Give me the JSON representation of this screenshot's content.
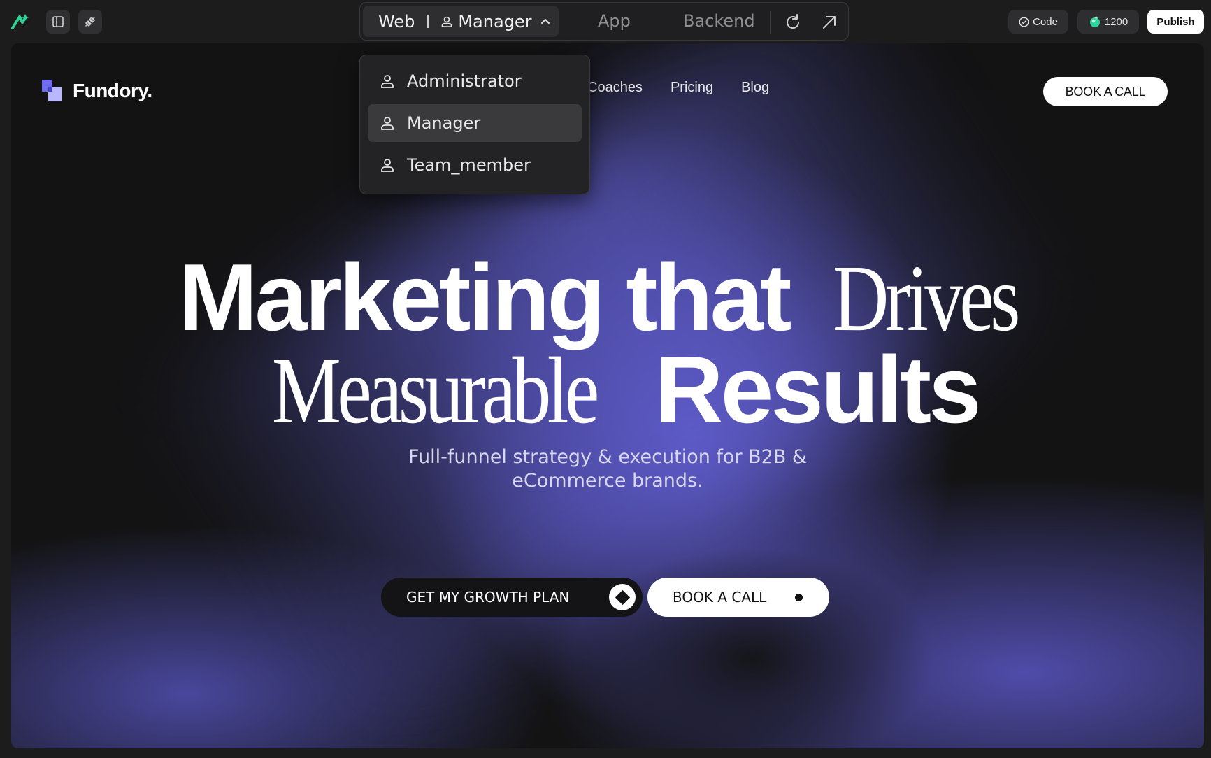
{
  "topbar": {
    "env_tabs": {
      "web": "Web",
      "role": "Manager",
      "app": "App",
      "backend": "Backend"
    },
    "code_label": "Code",
    "credits": "1200",
    "publish_label": "Publish"
  },
  "role_dropdown": {
    "items": [
      {
        "label": "Administrator"
      },
      {
        "label": "Manager",
        "selected": true
      },
      {
        "label": "Team_member"
      }
    ]
  },
  "site": {
    "brand": "Fundory.",
    "nav": [
      "Coaches",
      "Pricing",
      "Blog"
    ],
    "nav_cta": "BOOK A CALL",
    "hero": {
      "line1_sans": "Marketing that",
      "line1_serif": "Drives",
      "line2_serif": "Measurable",
      "line2_sans": "Results"
    },
    "subtitle": "Full-funnel strategy & execution for B2B & eCommerce brands.",
    "cta_primary": "GET MY GROWTH PLAN",
    "cta_secondary": "BOOK A CALL"
  },
  "colors": {
    "accent_purple": "#5a58c4",
    "brand_green": "#2ed399",
    "background": "#131314"
  }
}
